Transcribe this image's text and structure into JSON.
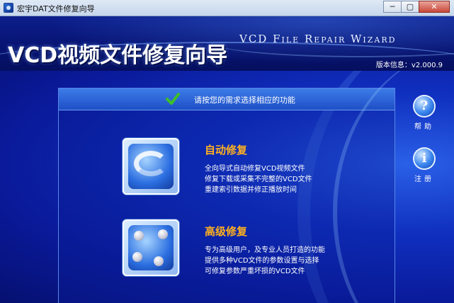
{
  "window": {
    "title": "宏宇DAT文件修复向导",
    "minimize_label": "─",
    "maximize_label": "▢",
    "close_label": "✕"
  },
  "header": {
    "title": "VCD视频文件修复向导",
    "subtitle_en": "VCD File Repair Wizard",
    "version": "版本信息：v2.000.9"
  },
  "panel": {
    "heading": "请按您的需求选择相应的功能",
    "options": [
      {
        "title": "自动修复",
        "lines": [
          "全向导式自动修复VCD视频文件",
          "修复下载或采集不完整的VCD文件",
          "重建索引数据并修正播放时间"
        ]
      },
      {
        "title": "高级修复",
        "lines": [
          "专为高级用户，及专业人员打造的功能",
          "提供多种VCD文件的参数设置与选择",
          "可修复参数严重坏损的VCD文件"
        ]
      }
    ]
  },
  "side": {
    "help": {
      "glyph": "?",
      "label": "帮助"
    },
    "register": {
      "glyph": "i",
      "label": "注册"
    }
  },
  "colors": {
    "option_title": "#ffb020",
    "accent_blue": "#1e4fc6",
    "check_green": "#3fbf2a"
  }
}
